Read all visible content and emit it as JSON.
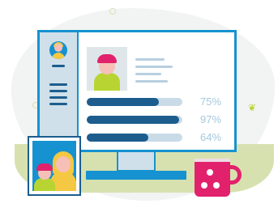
{
  "stats": {
    "rows": [
      {
        "fraction": 0.75,
        "label": "75%"
      },
      {
        "fraction": 0.97,
        "label": "97%"
      },
      {
        "fraction": 0.64,
        "label": "64%"
      }
    ]
  },
  "colors": {
    "primary_blue": "#1692d0",
    "dark_blue": "#1c5d8e",
    "magenta": "#e2216c",
    "lime": "#b8d432",
    "yellow": "#f4c842",
    "ground": "#d7e1b0"
  }
}
